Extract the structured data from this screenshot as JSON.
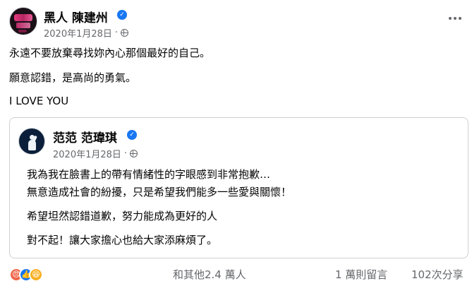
{
  "post": {
    "author": "黑人 陳建州",
    "date": "2020年1月28日",
    "dot": "·",
    "lines": [
      "永遠不要放棄尋找妳內心那個最好的自己。",
      "願意認錯，是高尚的勇氣。",
      "I LOVE YOU"
    ]
  },
  "shared_post": {
    "author": "范范 范瑋琪",
    "date": "2020年1月28日",
    "dot": "·",
    "lines": [
      "我為我在臉書上的帶有情緒性的字眼感到非常抱歉…",
      "無意造成社會的紛擾，只是希望我們能多一些愛與關懷！",
      "希望坦然認錯道歉，努力能成為更好的人",
      "對不起！讓大家擔心也給大家添麻煩了。"
    ]
  },
  "footer": {
    "reaction_icons": [
      "angry-reaction-icon",
      "like-reaction-icon",
      "haha-reaction-icon"
    ],
    "reactions_text": "和其他2.4 萬人",
    "comments_text": "1 萬則留言",
    "shares_text": "102次分享"
  },
  "colors": {
    "verified": "#1877f2",
    "meta_gray": "#65676b",
    "border": "#ced0d4"
  }
}
